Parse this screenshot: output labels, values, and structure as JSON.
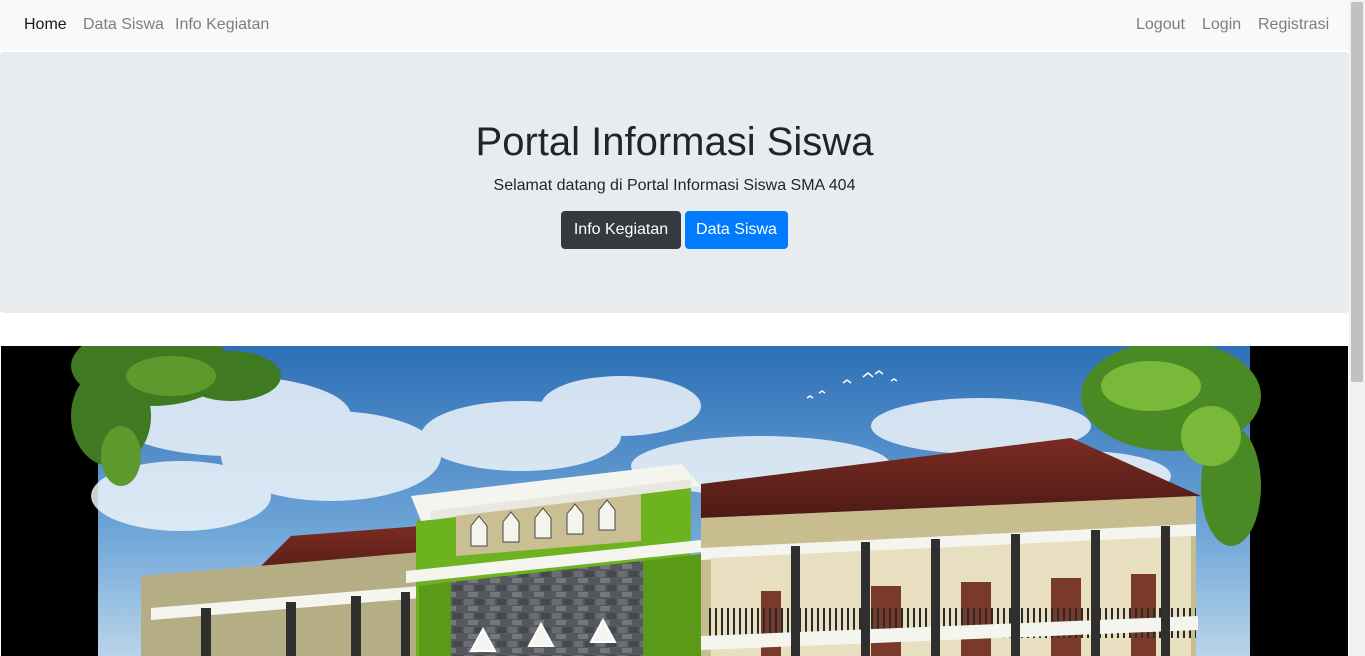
{
  "navbar": {
    "left_items": [
      {
        "label": "Home",
        "active": true
      },
      {
        "label": "Data Siswa",
        "active": false
      },
      {
        "label": "Info Kegiatan",
        "active": false
      }
    ],
    "right_items": [
      {
        "label": "Logout"
      },
      {
        "label": "Login"
      },
      {
        "label": "Registrasi"
      }
    ]
  },
  "hero": {
    "title": "Portal Informasi Siswa",
    "subtitle": "Selamat datang di Portal Informasi Siswa SMA 404",
    "buttons": [
      {
        "label": "Info Kegiatan",
        "style": "dark"
      },
      {
        "label": "Data Siswa",
        "style": "primary"
      }
    ]
  },
  "school_image": {
    "subject": "school-building-illustration"
  },
  "colors": {
    "navbar_bg": "#f8f9fa",
    "jumbotron_bg": "#e9ecef",
    "btn_dark": "#343a40",
    "btn_primary": "#007bff",
    "building_green": "#6db31f"
  }
}
